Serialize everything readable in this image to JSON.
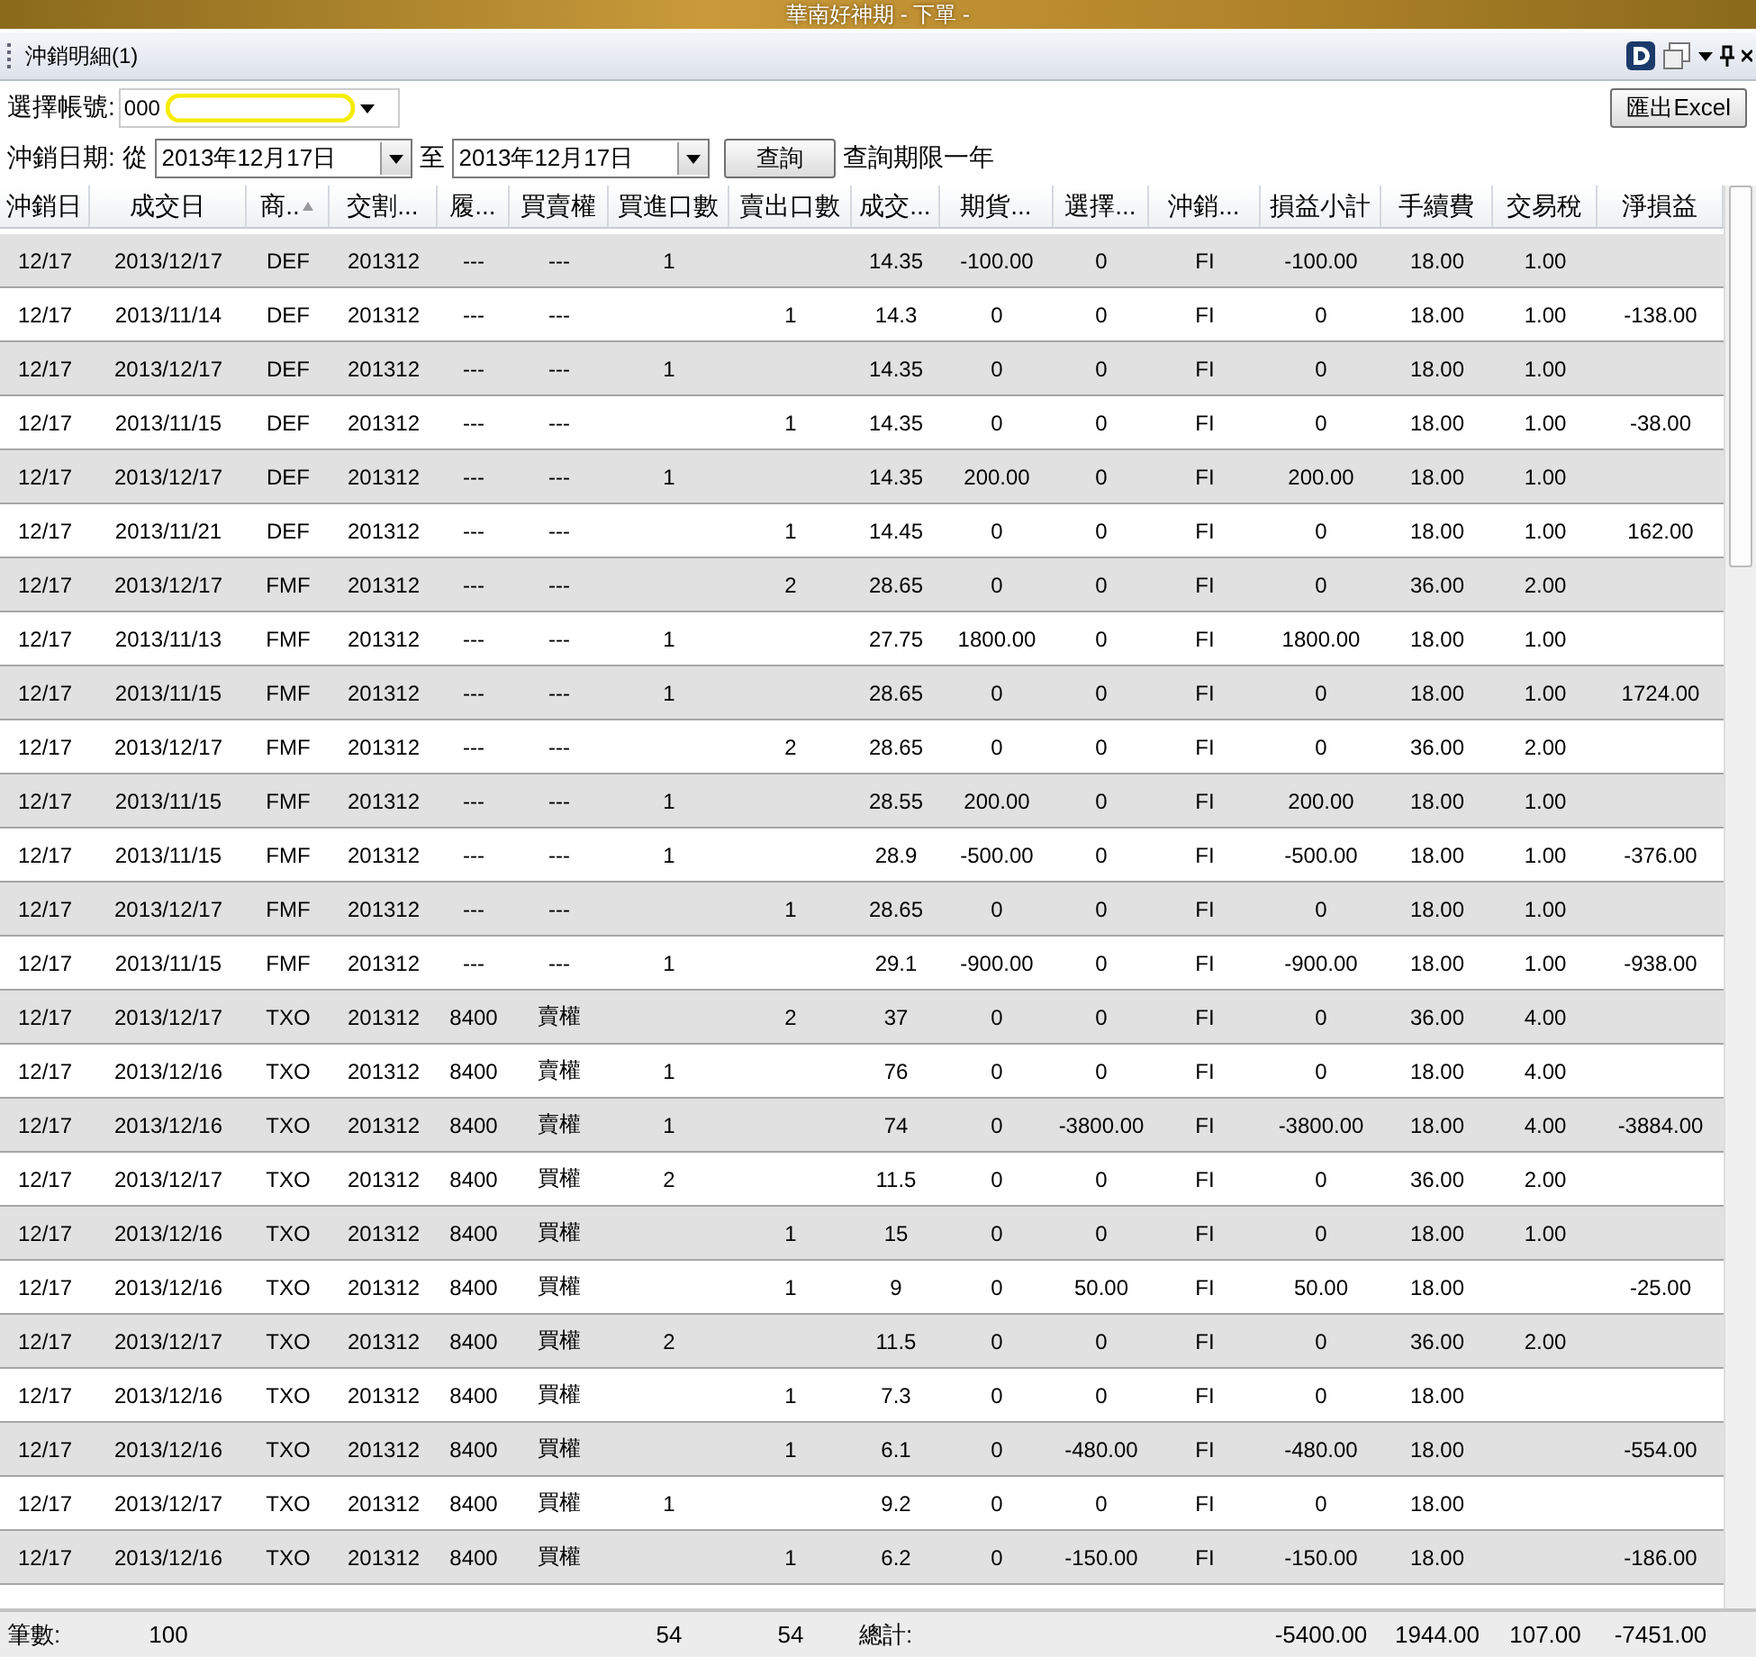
{
  "window": {
    "title": "華南好神期 - 下單 -"
  },
  "pane": {
    "title": "沖銷明細(1)"
  },
  "account": {
    "label": "選擇帳號:",
    "value": "000"
  },
  "export_button": "匯出Excel",
  "date_filter": {
    "label": "沖銷日期: 從",
    "from": "2013年12月17日",
    "to_label": "至",
    "to": "2013年12月17日",
    "query_button": "查詢",
    "note": "查詢期限一年"
  },
  "table": {
    "columns": [
      {
        "label": "沖銷日",
        "sorted": false
      },
      {
        "label": "成交日",
        "sorted": false
      },
      {
        "label": "商..",
        "sorted": true
      },
      {
        "label": "交割...",
        "sorted": false
      },
      {
        "label": "履...",
        "sorted": false
      },
      {
        "label": "買賣權",
        "sorted": false
      },
      {
        "label": "買進口數",
        "sorted": false
      },
      {
        "label": "賣出口數",
        "sorted": false
      },
      {
        "label": "成交...",
        "sorted": false
      },
      {
        "label": "期貨...",
        "sorted": false
      },
      {
        "label": "選擇...",
        "sorted": false
      },
      {
        "label": "沖銷...",
        "sorted": false
      },
      {
        "label": "損益小計",
        "sorted": false
      },
      {
        "label": "手續費",
        "sorted": false
      },
      {
        "label": "交易稅",
        "sorted": false
      },
      {
        "label": "淨損益",
        "sorted": false
      }
    ],
    "rows": [
      [
        "12/17",
        "2013/12/17",
        "DEF",
        "201312",
        "---",
        "---",
        "1",
        null,
        "14.35",
        "-100.00",
        "0",
        "FI",
        "-100.00",
        "18.00",
        "1.00",
        null
      ],
      [
        "12/17",
        "2013/11/14",
        "DEF",
        "201312",
        "---",
        "---",
        null,
        "1",
        "14.3",
        "0",
        "0",
        "FI",
        "0",
        "18.00",
        "1.00",
        "-138.00"
      ],
      [
        "12/17",
        "2013/12/17",
        "DEF",
        "201312",
        "---",
        "---",
        "1",
        null,
        "14.35",
        "0",
        "0",
        "FI",
        "0",
        "18.00",
        "1.00",
        null
      ],
      [
        "12/17",
        "2013/11/15",
        "DEF",
        "201312",
        "---",
        "---",
        null,
        "1",
        "14.35",
        "0",
        "0",
        "FI",
        "0",
        "18.00",
        "1.00",
        "-38.00"
      ],
      [
        "12/17",
        "2013/12/17",
        "DEF",
        "201312",
        "---",
        "---",
        "1",
        null,
        "14.35",
        "200.00",
        "0",
        "FI",
        "200.00",
        "18.00",
        "1.00",
        null
      ],
      [
        "12/17",
        "2013/11/21",
        "DEF",
        "201312",
        "---",
        "---",
        null,
        "1",
        "14.45",
        "0",
        "0",
        "FI",
        "0",
        "18.00",
        "1.00",
        "162.00"
      ],
      [
        "12/17",
        "2013/12/17",
        "FMF",
        "201312",
        "---",
        "---",
        null,
        "2",
        "28.65",
        "0",
        "0",
        "FI",
        "0",
        "36.00",
        "2.00",
        null
      ],
      [
        "12/17",
        "2013/11/13",
        "FMF",
        "201312",
        "---",
        "---",
        "1",
        null,
        "27.75",
        "1800.00",
        "0",
        "FI",
        "1800.00",
        "18.00",
        "1.00",
        null
      ],
      [
        "12/17",
        "2013/11/15",
        "FMF",
        "201312",
        "---",
        "---",
        "1",
        null,
        "28.65",
        "0",
        "0",
        "FI",
        "0",
        "18.00",
        "1.00",
        "1724.00"
      ],
      [
        "12/17",
        "2013/12/17",
        "FMF",
        "201312",
        "---",
        "---",
        null,
        "2",
        "28.65",
        "0",
        "0",
        "FI",
        "0",
        "36.00",
        "2.00",
        null
      ],
      [
        "12/17",
        "2013/11/15",
        "FMF",
        "201312",
        "---",
        "---",
        "1",
        null,
        "28.55",
        "200.00",
        "0",
        "FI",
        "200.00",
        "18.00",
        "1.00",
        null
      ],
      [
        "12/17",
        "2013/11/15",
        "FMF",
        "201312",
        "---",
        "---",
        "1",
        null,
        "28.9",
        "-500.00",
        "0",
        "FI",
        "-500.00",
        "18.00",
        "1.00",
        "-376.00"
      ],
      [
        "12/17",
        "2013/12/17",
        "FMF",
        "201312",
        "---",
        "---",
        null,
        "1",
        "28.65",
        "0",
        "0",
        "FI",
        "0",
        "18.00",
        "1.00",
        null
      ],
      [
        "12/17",
        "2013/11/15",
        "FMF",
        "201312",
        "---",
        "---",
        "1",
        null,
        "29.1",
        "-900.00",
        "0",
        "FI",
        "-900.00",
        "18.00",
        "1.00",
        "-938.00"
      ],
      [
        "12/17",
        "2013/12/17",
        "TXO",
        "201312",
        "8400",
        "賣權",
        null,
        "2",
        "37",
        "0",
        "0",
        "FI",
        "0",
        "36.00",
        "4.00",
        null
      ],
      [
        "12/17",
        "2013/12/16",
        "TXO",
        "201312",
        "8400",
        "賣權",
        "1",
        null,
        "76",
        "0",
        "0",
        "FI",
        "0",
        "18.00",
        "4.00",
        null
      ],
      [
        "12/17",
        "2013/12/16",
        "TXO",
        "201312",
        "8400",
        "賣權",
        "1",
        null,
        "74",
        "0",
        "-3800.00",
        "FI",
        "-3800.00",
        "18.00",
        "4.00",
        "-3884.00"
      ],
      [
        "12/17",
        "2013/12/17",
        "TXO",
        "201312",
        "8400",
        "買權",
        "2",
        null,
        "11.5",
        "0",
        "0",
        "FI",
        "0",
        "36.00",
        "2.00",
        null
      ],
      [
        "12/17",
        "2013/12/16",
        "TXO",
        "201312",
        "8400",
        "買權",
        null,
        "1",
        "15",
        "0",
        "0",
        "FI",
        "0",
        "18.00",
        "1.00",
        null
      ],
      [
        "12/17",
        "2013/12/16",
        "TXO",
        "201312",
        "8400",
        "買權",
        null,
        "1",
        "9",
        "0",
        "50.00",
        "FI",
        "50.00",
        "18.00",
        null,
        "-25.00"
      ],
      [
        "12/17",
        "2013/12/17",
        "TXO",
        "201312",
        "8400",
        "買權",
        "2",
        null,
        "11.5",
        "0",
        "0",
        "FI",
        "0",
        "36.00",
        "2.00",
        null
      ],
      [
        "12/17",
        "2013/12/16",
        "TXO",
        "201312",
        "8400",
        "買權",
        null,
        "1",
        "7.3",
        "0",
        "0",
        "FI",
        "0",
        "18.00",
        null,
        null
      ],
      [
        "12/17",
        "2013/12/16",
        "TXO",
        "201312",
        "8400",
        "買權",
        null,
        "1",
        "6.1",
        "0",
        "-480.00",
        "FI",
        "-480.00",
        "18.00",
        null,
        "-554.00"
      ],
      [
        "12/17",
        "2013/12/17",
        "TXO",
        "201312",
        "8400",
        "買權",
        "1",
        null,
        "9.2",
        "0",
        "0",
        "FI",
        "0",
        "18.00",
        null,
        null
      ],
      [
        "12/17",
        "2013/12/16",
        "TXO",
        "201312",
        "8400",
        "買權",
        null,
        "1",
        "6.2",
        "0",
        "-150.00",
        "FI",
        "-150.00",
        "18.00",
        null,
        "-186.00"
      ]
    ]
  },
  "footer": {
    "count_label": "筆數:",
    "count": "100",
    "buy_total": "54",
    "sell_total": "54",
    "total_label": "總計:",
    "pl_total": "-5400.00",
    "fee_total": "1944.00",
    "tax_total": "107.00",
    "net_total": "-7451.00"
  }
}
